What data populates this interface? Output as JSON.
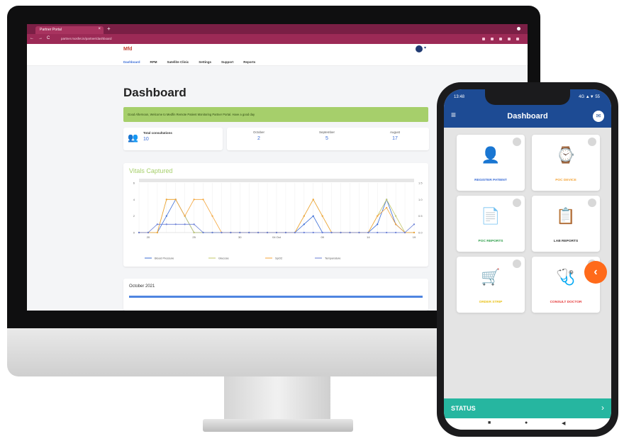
{
  "browser": {
    "tab_title": "Partner Portal",
    "tab_close": "×",
    "new_tab": "+",
    "url": "partner.mosfet.in/partner/dashboard",
    "back": "←",
    "forward": "→",
    "reload": "C"
  },
  "portal": {
    "logo": "Mfd",
    "user_caret": "▾",
    "menu": [
      "Dashboard",
      "RPM",
      "Satellite Clinic",
      "Settings",
      "Support",
      "Reports"
    ],
    "page_title": "Dashboard",
    "greeting": "Good Afternoon, Welcome to Medfin Remote Patient Monitoring Partner Portal. Have a good day",
    "total_consultations": {
      "label": "Total consultations",
      "value": "10"
    },
    "months": [
      {
        "name": "October",
        "value": "2"
      },
      {
        "name": "September",
        "value": "5"
      },
      {
        "name": "August",
        "value": "17"
      }
    ],
    "vitals": {
      "title": "Vitals Captured"
    },
    "monthly": {
      "title": "October 2021"
    }
  },
  "chart_data": {
    "type": "line",
    "x": [
      1,
      2,
      3,
      4,
      5,
      6,
      7,
      8,
      9,
      10,
      11,
      12,
      13,
      14,
      15,
      16,
      17,
      18,
      19,
      20,
      21,
      22,
      23,
      24,
      25,
      26,
      27,
      28,
      29,
      30,
      31
    ],
    "y_left_ticks": [
      "0",
      "2",
      "4",
      "6"
    ],
    "y_right_ticks": [
      "0.0",
      "0.5",
      "1.0",
      "1.5"
    ],
    "x_ticks": [
      {
        "x": 2,
        "label": "20"
      },
      {
        "x": 7,
        "label": "25"
      },
      {
        "x": 12,
        "label": "30"
      },
      {
        "x": 16,
        "label": "04 Oct"
      },
      {
        "x": 21,
        "label": "09"
      },
      {
        "x": 26,
        "label": "14"
      },
      {
        "x": 31,
        "label": "19"
      }
    ],
    "ylim": [
      0,
      6
    ],
    "series": [
      {
        "name": "Blood Pressure",
        "color": "#3b6dd6",
        "values": [
          0,
          0,
          0,
          2,
          4,
          2,
          0,
          0,
          0,
          0,
          0,
          0,
          0,
          0,
          0,
          0,
          0,
          0,
          1,
          2,
          0,
          0,
          0,
          0,
          0,
          0,
          1,
          4,
          1,
          0,
          0
        ]
      },
      {
        "name": "Glucose",
        "color": "#c3c86a",
        "values": [
          0,
          0,
          0,
          4,
          4,
          2,
          0,
          0,
          0,
          0,
          0,
          0,
          0,
          0,
          0,
          0,
          0,
          0,
          2,
          4,
          2,
          0,
          0,
          0,
          0,
          0,
          2,
          4,
          2,
          0,
          0
        ]
      },
      {
        "name": "SpO2",
        "color": "#f4a53a",
        "values": [
          0,
          0,
          0,
          4,
          4,
          2,
          4,
          4,
          2,
          0,
          0,
          0,
          0,
          0,
          0,
          0,
          0,
          0,
          2,
          4,
          2,
          0,
          0,
          0,
          0,
          0,
          2,
          3,
          1,
          0,
          0
        ]
      },
      {
        "name": "Temperature",
        "color": "#6a7fd6",
        "values": [
          0,
          0,
          1,
          1,
          1,
          1,
          1,
          0,
          0,
          0,
          0,
          0,
          0,
          0,
          0,
          0,
          0,
          0,
          0,
          0,
          0,
          0,
          0,
          0,
          0,
          0,
          0,
          0,
          0,
          0,
          1
        ]
      }
    ]
  },
  "phone": {
    "time": "13:48",
    "signal": "4G ▲▼ 55",
    "title": "Dashboard",
    "tiles": [
      {
        "label": "REGISTER PATIENT",
        "icon": "👤",
        "color": "#3b6dd6"
      },
      {
        "label": "POC DEVICE",
        "icon": "⌚",
        "color": "#f4a53a"
      },
      {
        "label": "POC REPORTS",
        "icon": "📄",
        "color": "#2e9e4a"
      },
      {
        "label": "LAB REPORTS",
        "icon": "📋",
        "color": "#333333"
      },
      {
        "label": "ORDER STRIP",
        "icon": "🛒",
        "color": "#e9c21a"
      },
      {
        "label": "CONSULT DOCTOR",
        "icon": "🩺",
        "color": "#e53b3b"
      }
    ],
    "fab": "‹",
    "status": "STATUS",
    "status_arrow": "›",
    "nav": [
      "■",
      "●",
      "◀"
    ]
  },
  "colors": {
    "brand_maroon": "#9c2a56",
    "accent_blue": "#1d4b94",
    "status_teal": "#26b6a0",
    "green": "#a6cf6b",
    "orange": "#ff6a1a"
  }
}
